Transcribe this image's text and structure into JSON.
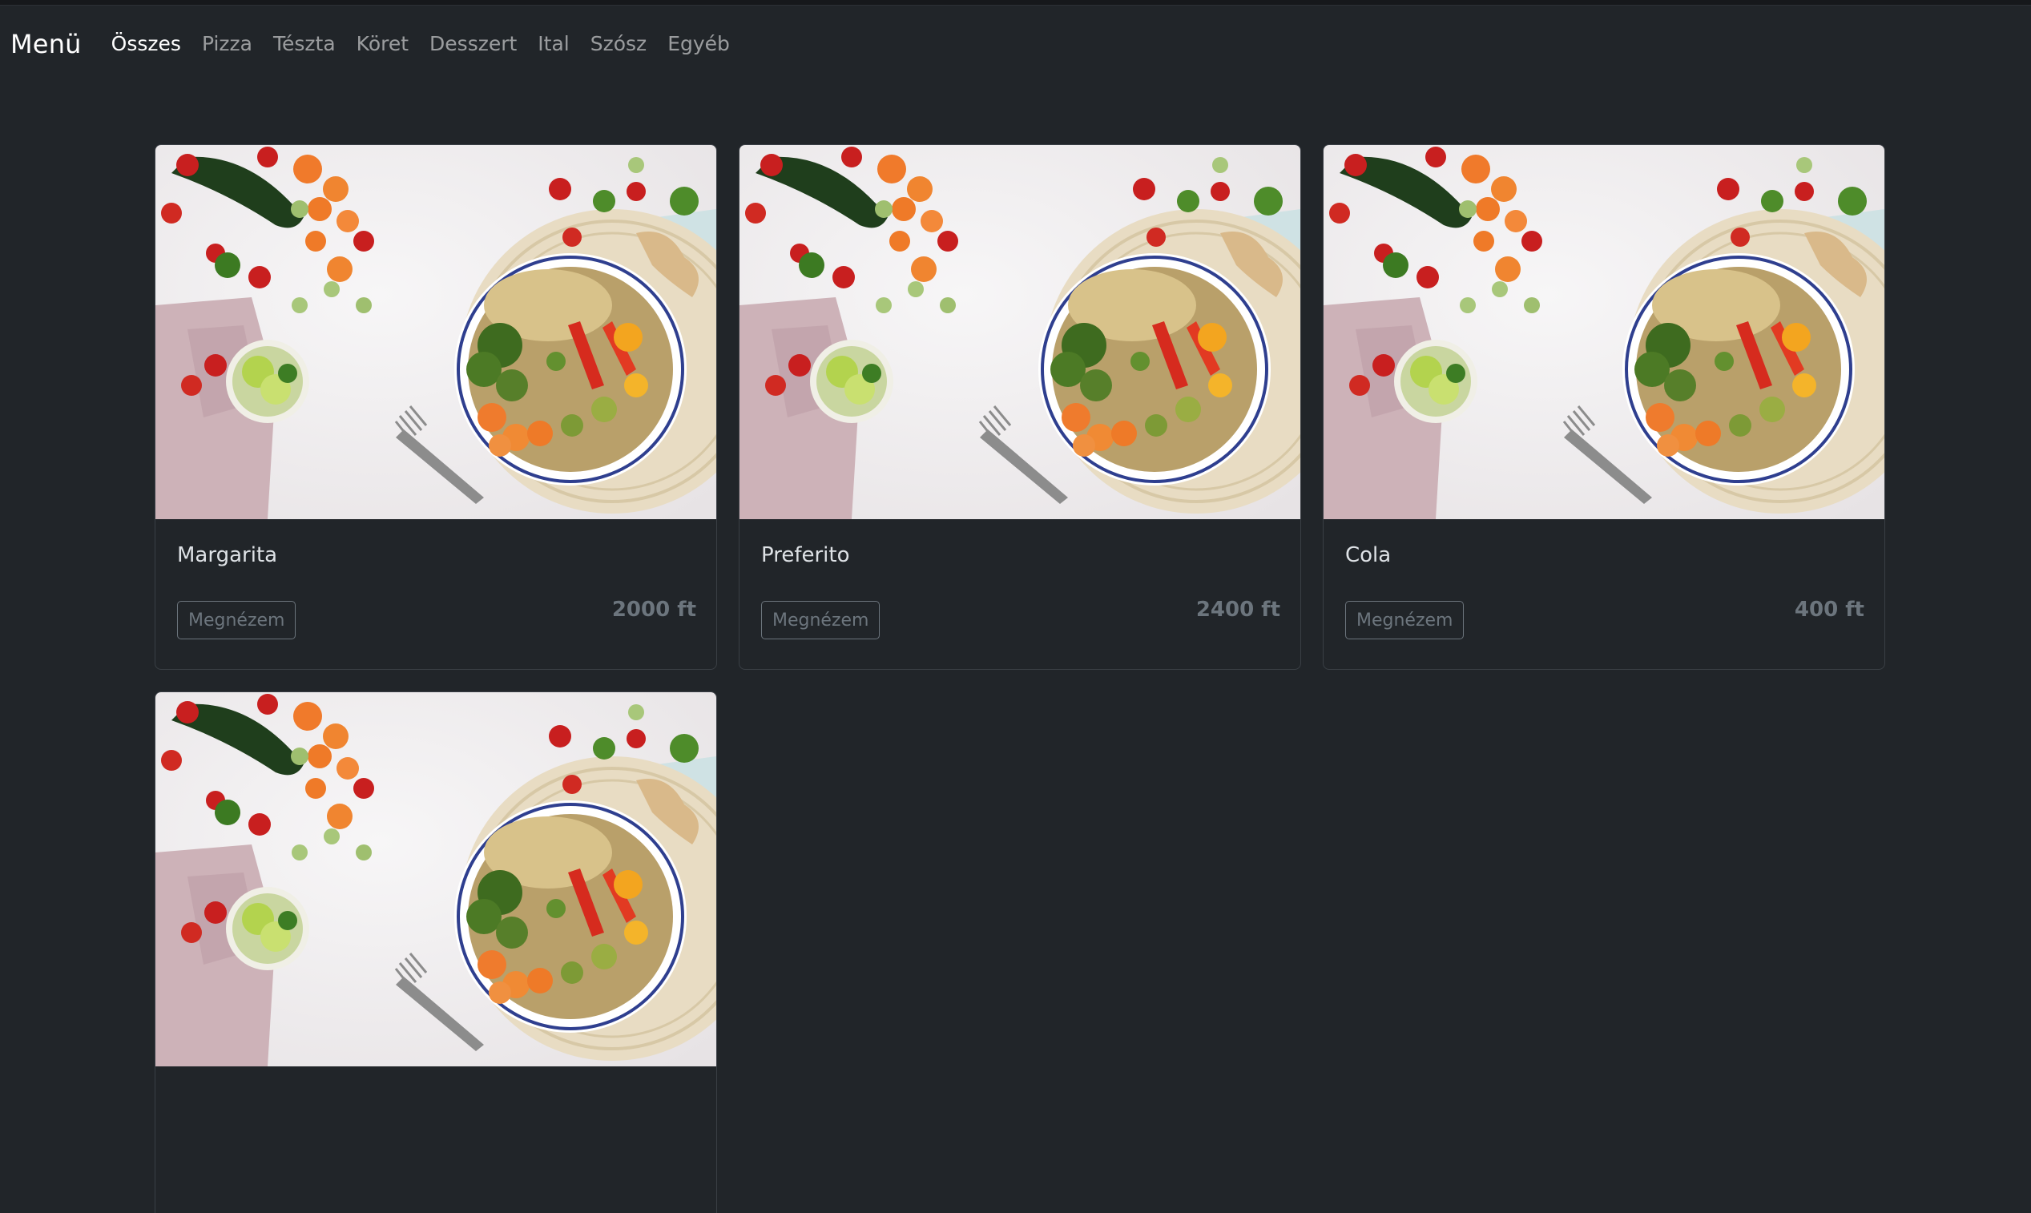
{
  "navbar": {
    "brand": "Menü",
    "links": [
      {
        "label": "Összes",
        "active": true
      },
      {
        "label": "Pizza",
        "active": false
      },
      {
        "label": "Tészta",
        "active": false
      },
      {
        "label": "Köret",
        "active": false
      },
      {
        "label": "Desszert",
        "active": false
      },
      {
        "label": "Ital",
        "active": false
      },
      {
        "label": "Szósz",
        "active": false
      },
      {
        "label": "Egyéb",
        "active": false
      }
    ]
  },
  "products": [
    {
      "name": "Margarita",
      "button": "Megnézem",
      "price": "2000 ft",
      "image": "food-bowl-photo"
    },
    {
      "name": "Preferito",
      "button": "Megnézem",
      "price": "2400 ft",
      "image": "food-bowl-photo"
    },
    {
      "name": "Cola",
      "button": "Megnézem",
      "price": "400 ft",
      "image": "food-bowl-photo"
    },
    {
      "image": "food-bowl-photo"
    }
  ],
  "colors": {
    "background": "#212529",
    "card_border": "#3a3f45",
    "muted": "#6c757d",
    "nav_active": "#ffffff"
  }
}
